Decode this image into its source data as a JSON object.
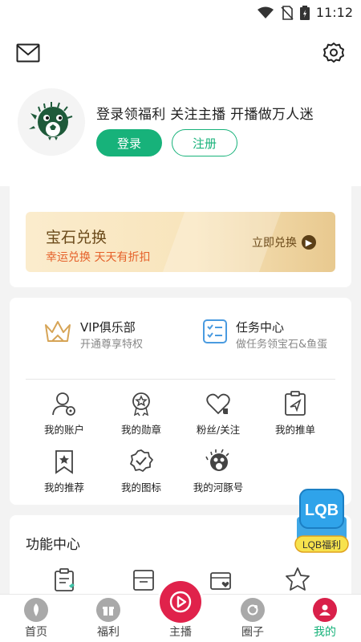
{
  "status": {
    "time": "11:12"
  },
  "profile": {
    "tagline": "登录领福利 关注主播 开播做万人迷",
    "login_label": "登录",
    "register_label": "注册"
  },
  "gem": {
    "title": "宝石兑换",
    "subtitle": "幸运兑换 天天有折扣",
    "action": "立即兑换"
  },
  "menu": {
    "vip": {
      "title": "VIP俱乐部",
      "subtitle": "开通尊享特权"
    },
    "task": {
      "title": "任务中心",
      "subtitle": "做任务领宝石&鱼蛋"
    },
    "grid": [
      {
        "label": "我的账户",
        "icon": "account-icon"
      },
      {
        "label": "我的勋章",
        "icon": "medal-icon"
      },
      {
        "label": "粉丝/关注",
        "icon": "heart-icon"
      },
      {
        "label": "我的推单",
        "icon": "paper-plane-icon"
      },
      {
        "label": "我的推荐",
        "icon": "bookmark-star-icon"
      },
      {
        "label": "我的图标",
        "icon": "check-badge-icon"
      },
      {
        "label": "我的河豚号",
        "icon": "pufferfish-icon"
      }
    ]
  },
  "func": {
    "title": "功能中心"
  },
  "lqb": {
    "badge": "LQB",
    "label": "LQB福利"
  },
  "tabs": [
    {
      "label": "首页",
      "icon": "home-icon"
    },
    {
      "label": "福利",
      "icon": "gift-icon"
    },
    {
      "label": "主播",
      "icon": "play-icon"
    },
    {
      "label": "圈子",
      "icon": "circle-icon"
    },
    {
      "label": "我的",
      "icon": "user-icon"
    }
  ],
  "colors": {
    "accent": "#17b27a",
    "live": "#e0224b",
    "gold": "#6b4a1a",
    "orange": "#e5612a"
  }
}
